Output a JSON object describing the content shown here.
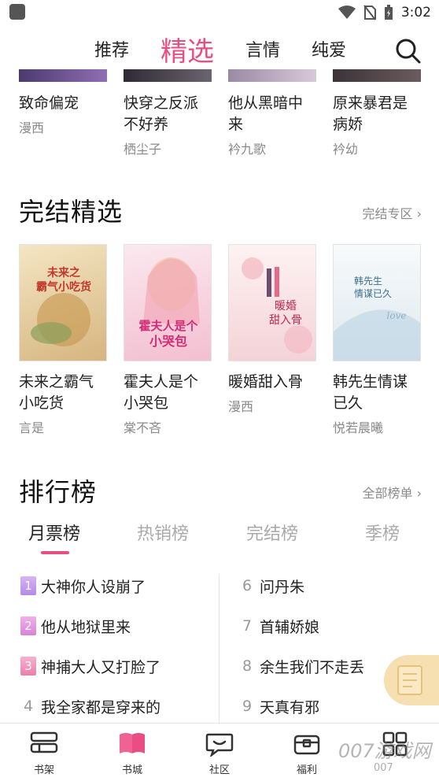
{
  "status": {
    "time": "3:02"
  },
  "top_tabs": [
    {
      "label": "推荐",
      "active": false
    },
    {
      "label": "精选",
      "active": true
    },
    {
      "label": "言情",
      "active": false
    },
    {
      "label": "纯爱",
      "active": false
    }
  ],
  "recommend_books": [
    {
      "title": "致命偏宠",
      "author": "漫西"
    },
    {
      "title": "快穿之反派不好养",
      "author": "栖尘子"
    },
    {
      "title": "他从黑暗中来",
      "author": "衿九歌"
    },
    {
      "title": "原来暴君是病娇",
      "author": "衿幼"
    }
  ],
  "completed": {
    "title": "完结精选",
    "more": "完结专区",
    "books": [
      {
        "title": "未来之霸气小吃货",
        "author": "言是",
        "cover_text": "未来之霸气小吃货",
        "cover_color": "#e9d3a3"
      },
      {
        "title": "霍夫人是个小哭包",
        "author": "棠不吝",
        "cover_text": "霍夫人是个小哭包",
        "cover_color": "#f6d6e2"
      },
      {
        "title": "暖婚甜入骨",
        "author": "漫西",
        "cover_text": "暖婚甜入骨",
        "cover_color": "#f7e1e4"
      },
      {
        "title": "韩先生情谋已久",
        "author": "悦若晨曦",
        "cover_text": "韩先生情谋已久",
        "cover_color": "#eef3f6"
      }
    ]
  },
  "ranking": {
    "title": "排行榜",
    "more": "全部榜单",
    "tabs": [
      {
        "label": "月票榜",
        "active": true
      },
      {
        "label": "热销榜",
        "active": false
      },
      {
        "label": "完结榜",
        "active": false
      },
      {
        "label": "季榜",
        "active": false
      }
    ],
    "left": [
      {
        "rank": "1",
        "name": "大神你人设崩了"
      },
      {
        "rank": "2",
        "name": "他从地狱里来"
      },
      {
        "rank": "3",
        "name": "神捕大人又打脸了"
      },
      {
        "rank": "4",
        "name": "我全家都是穿来的"
      }
    ],
    "right": [
      {
        "rank": "6",
        "name": "问丹朱"
      },
      {
        "rank": "7",
        "name": "首辅娇娘"
      },
      {
        "rank": "8",
        "name": "余生我们不走丢"
      },
      {
        "rank": "9",
        "name": "天真有邪"
      }
    ]
  },
  "bottom_nav": [
    {
      "label": "书架",
      "active": false
    },
    {
      "label": "书城",
      "active": true
    },
    {
      "label": "社区",
      "active": false
    },
    {
      "label": "福利",
      "active": false
    },
    {
      "label": "",
      "active": false
    }
  ],
  "watermark": {
    "main": "007游戏网",
    "sub": "007"
  },
  "colors": {
    "accent": "#e84e83",
    "rank_badges": [
      "#c59cf0",
      "#e79be0",
      "#f29ac2"
    ]
  }
}
